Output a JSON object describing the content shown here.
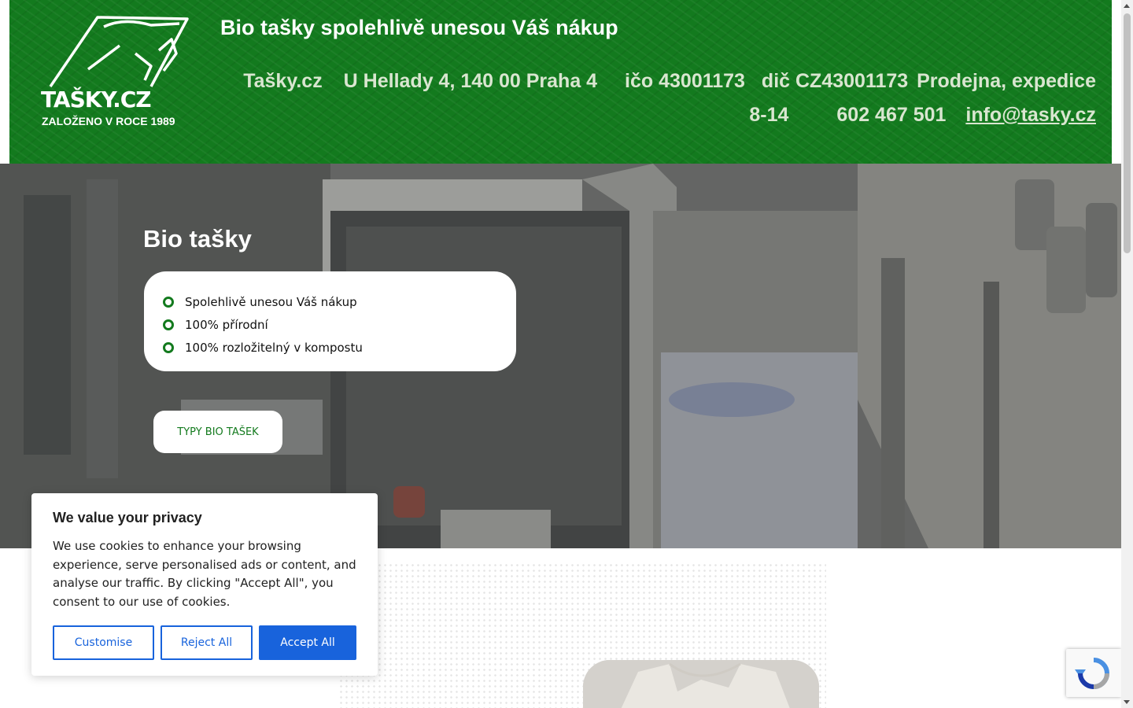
{
  "header": {
    "logo": {
      "name": "TAŠKY.CZ",
      "subtitle": "ZALOŽENO V ROCE 1989"
    },
    "tagline": "Bio tašky spolehlivě unesou Váš nákup",
    "contact": {
      "brand": "Tašky.cz",
      "address": "U Hellady 4, 140 00 Praha 4",
      "ico": "ičo 43001173",
      "dic": "dič CZ43001173",
      "hours": "Prodejna, expedice 8-14",
      "phone": "602 467 501",
      "email": "info@tasky.cz"
    }
  },
  "hero": {
    "title": "Bio tašky",
    "features": [
      "Spolehlivě unesou Váš nákup",
      "100% přírodní",
      "100% rozložitelný v kompostu"
    ],
    "cta_label": "TYPY BIO TAŠEK"
  },
  "cookie": {
    "title": "We value your privacy",
    "text": "We use cookies to enhance your browsing experience, serve personalised ads or content, and analyse our traffic. By clicking \"Accept All\", you consent to our use of cookies.",
    "customise_label": "Customise",
    "reject_label": "Reject All",
    "accept_label": "Accept All"
  },
  "colors": {
    "brand_green": "#137a1e",
    "cookie_blue": "#1863dc"
  },
  "icons": {
    "bullet": "green-ring-bullet-icon",
    "recaptcha": "recaptcha-icon"
  }
}
